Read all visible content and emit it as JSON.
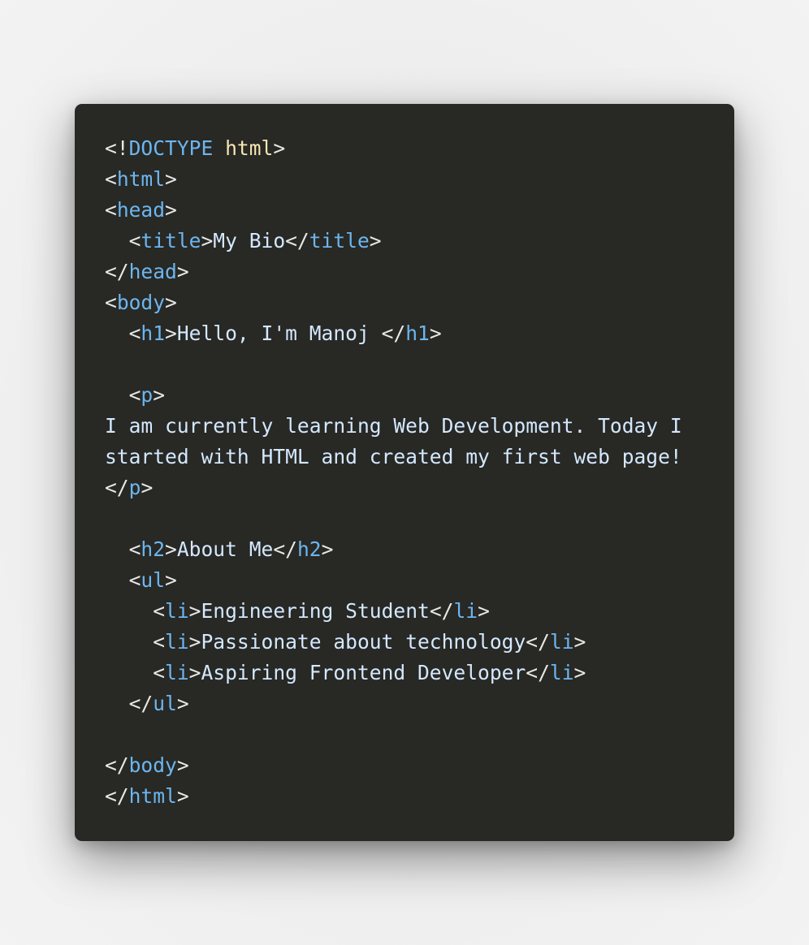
{
  "code_lines": [
    [
      {
        "c": "p",
        "v": "<!"
      },
      {
        "c": "t",
        "v": "DOCTYPE"
      },
      {
        "c": "p",
        "v": " "
      },
      {
        "c": "k",
        "v": "html"
      },
      {
        "c": "p",
        "v": ">"
      }
    ],
    [
      {
        "c": "p",
        "v": "<"
      },
      {
        "c": "t",
        "v": "html"
      },
      {
        "c": "p",
        "v": ">"
      }
    ],
    [
      {
        "c": "p",
        "v": "<"
      },
      {
        "c": "t",
        "v": "head"
      },
      {
        "c": "p",
        "v": ">"
      }
    ],
    [
      {
        "c": "p",
        "v": "  <"
      },
      {
        "c": "t",
        "v": "title"
      },
      {
        "c": "p",
        "v": ">"
      },
      {
        "c": "x",
        "v": "My Bio"
      },
      {
        "c": "p",
        "v": "</"
      },
      {
        "c": "t",
        "v": "title"
      },
      {
        "c": "p",
        "v": ">"
      }
    ],
    [
      {
        "c": "p",
        "v": "</"
      },
      {
        "c": "t",
        "v": "head"
      },
      {
        "c": "p",
        "v": ">"
      }
    ],
    [
      {
        "c": "p",
        "v": "<"
      },
      {
        "c": "t",
        "v": "body"
      },
      {
        "c": "p",
        "v": ">"
      }
    ],
    [
      {
        "c": "p",
        "v": "  <"
      },
      {
        "c": "t",
        "v": "h1"
      },
      {
        "c": "p",
        "v": ">"
      },
      {
        "c": "x",
        "v": "Hello, I'm Manoj "
      },
      {
        "c": "p",
        "v": "</"
      },
      {
        "c": "t",
        "v": "h1"
      },
      {
        "c": "p",
        "v": ">"
      }
    ],
    [],
    [
      {
        "c": "p",
        "v": "  <"
      },
      {
        "c": "t",
        "v": "p"
      },
      {
        "c": "p",
        "v": ">"
      }
    ],
    [
      {
        "c": "x",
        "v": "I am currently learning Web Development. Today I"
      }
    ],
    [
      {
        "c": "x",
        "v": "started with HTML and created my first web page!"
      }
    ],
    [
      {
        "c": "p",
        "v": "</"
      },
      {
        "c": "t",
        "v": "p"
      },
      {
        "c": "p",
        "v": ">"
      }
    ],
    [],
    [
      {
        "c": "p",
        "v": "  <"
      },
      {
        "c": "t",
        "v": "h2"
      },
      {
        "c": "p",
        "v": ">"
      },
      {
        "c": "x",
        "v": "About Me"
      },
      {
        "c": "p",
        "v": "</"
      },
      {
        "c": "t",
        "v": "h2"
      },
      {
        "c": "p",
        "v": ">"
      }
    ],
    [
      {
        "c": "p",
        "v": "  <"
      },
      {
        "c": "t",
        "v": "ul"
      },
      {
        "c": "p",
        "v": ">"
      }
    ],
    [
      {
        "c": "p",
        "v": "    <"
      },
      {
        "c": "t",
        "v": "li"
      },
      {
        "c": "p",
        "v": ">"
      },
      {
        "c": "x",
        "v": "Engineering Student"
      },
      {
        "c": "p",
        "v": "</"
      },
      {
        "c": "t",
        "v": "li"
      },
      {
        "c": "p",
        "v": ">"
      }
    ],
    [
      {
        "c": "p",
        "v": "    <"
      },
      {
        "c": "t",
        "v": "li"
      },
      {
        "c": "p",
        "v": ">"
      },
      {
        "c": "x",
        "v": "Passionate about technology"
      },
      {
        "c": "p",
        "v": "</"
      },
      {
        "c": "t",
        "v": "li"
      },
      {
        "c": "p",
        "v": ">"
      }
    ],
    [
      {
        "c": "p",
        "v": "    <"
      },
      {
        "c": "t",
        "v": "li"
      },
      {
        "c": "p",
        "v": ">"
      },
      {
        "c": "x",
        "v": "Aspiring Frontend Developer"
      },
      {
        "c": "p",
        "v": "</"
      },
      {
        "c": "t",
        "v": "li"
      },
      {
        "c": "p",
        "v": ">"
      }
    ],
    [
      {
        "c": "p",
        "v": "  </"
      },
      {
        "c": "t",
        "v": "ul"
      },
      {
        "c": "p",
        "v": ">"
      }
    ],
    [],
    [
      {
        "c": "p",
        "v": "</"
      },
      {
        "c": "t",
        "v": "body"
      },
      {
        "c": "p",
        "v": ">"
      }
    ],
    [
      {
        "c": "p",
        "v": "</"
      },
      {
        "c": "t",
        "v": "html"
      },
      {
        "c": "p",
        "v": ">"
      }
    ]
  ],
  "colors": {
    "card_background": "#282824",
    "punctuation": "#e8e8e8",
    "tag_name": "#6cb6f0",
    "keyword": "#f6e7b4",
    "text": "#d3e8ff"
  }
}
